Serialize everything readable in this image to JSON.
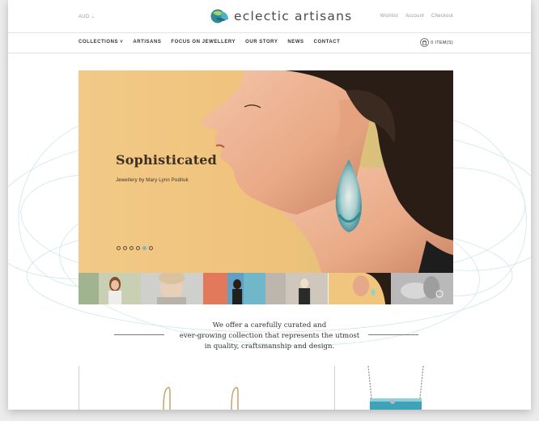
{
  "header": {
    "currency": "AUD",
    "logo_text": "eclectic artisans",
    "account_links": [
      "Wishlist",
      "Account",
      "Checkout"
    ]
  },
  "nav": {
    "items": [
      "COLLECTIONS",
      "ARTISANS",
      "FOCUS ON JEWELLERY",
      "OUR STORY",
      "NEWS",
      "CONTACT"
    ],
    "cart_label": "0 ITEM(S)"
  },
  "hero": {
    "title": "Sophisticated",
    "subtitle": "Jewellery by Mary Lynn Podiluk",
    "slide_count": 6,
    "active_slide": 4
  },
  "tagline": {
    "lines": [
      "We offer a carefully curated and",
      "ever-growing collection that represents the utmost",
      "in quality, craftsmanship and design."
    ]
  },
  "colors": {
    "accent": "#7fb4c0",
    "hero_bg": "#f2c987",
    "swirl": "#cfe6ea"
  }
}
